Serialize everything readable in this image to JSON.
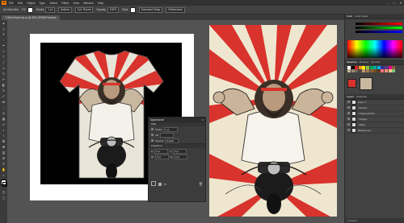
{
  "menubar": {
    "logo": "Ai",
    "items": [
      "File",
      "Edit",
      "Object",
      "Type",
      "Select",
      "Effect",
      "View",
      "Window",
      "Help"
    ],
    "controls": [
      "–",
      "□",
      "✕"
    ]
  },
  "controlbar": {
    "selection_label": "No Selection",
    "fill_label": "Fill",
    "stroke_label": "Stroke",
    "stroke_value": "1 pt",
    "style_label": "Uniform",
    "brush_label": "5 pt. Round",
    "opacity_label": "Opacity",
    "opacity_value": "100%",
    "style2_label": "Style",
    "doc_setup": "Document Setup",
    "prefs": "Preferences"
  },
  "document": {
    "tab_title": "T-Shirt Mock Up.ai @ 50% (RGB/Preview)"
  },
  "floating_panel": {
    "title": "Appearance",
    "section1": "Path",
    "rows": [
      {
        "label": "Stroke",
        "value": "1 pt"
      },
      {
        "label": "Fill",
        "value": ""
      },
      {
        "label": "Opacity",
        "value": "Default"
      }
    ],
    "section2": "Transform",
    "fields": [
      {
        "label": "X",
        "value": "0 px"
      },
      {
        "label": "Y",
        "value": "0 px"
      },
      {
        "label": "W",
        "value": "0 px"
      },
      {
        "label": "H",
        "value": "0 px"
      }
    ]
  },
  "right_panel": {
    "tabs_top": [
      "Color",
      "Color Guide"
    ],
    "tabs_swatch": [
      "Swatches",
      "Brushes",
      "Symbols"
    ],
    "tabs_layers": [
      "Layers",
      "Artboards"
    ],
    "layers": [
      "Layer 1",
      "<Group>",
      "<Clipping Path>",
      "<Image>",
      "<Path>",
      "Background"
    ],
    "footer": "2 Layers"
  },
  "colors": {
    "accent_red": "#d8332c",
    "shirt_cream": "#e9e4d8",
    "poster_bg": "#efe6cf"
  }
}
